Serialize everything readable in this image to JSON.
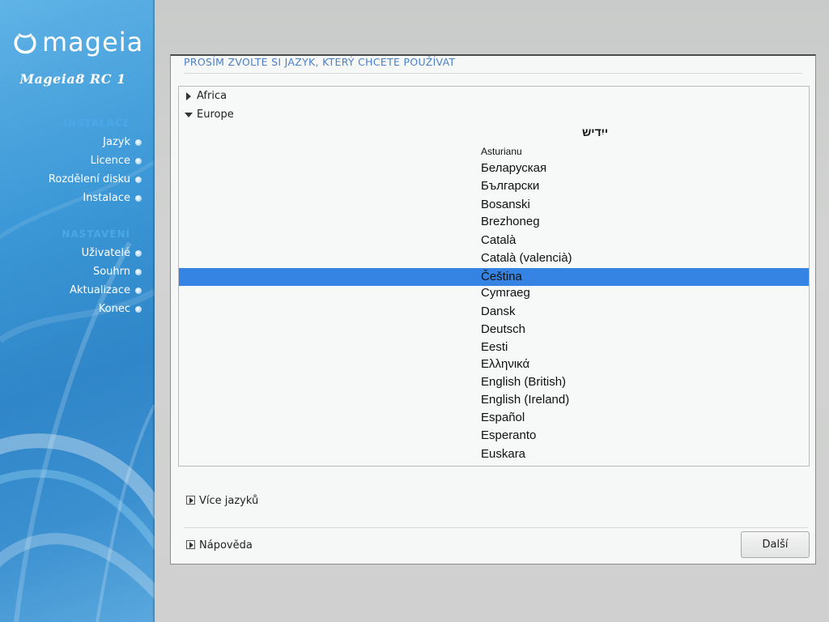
{
  "colors": {
    "sidebar_blue": "#3b97d6",
    "title_blue": "#4c80c6",
    "section_blue": "#4aa7e8",
    "selection": "#3584e4"
  },
  "sidebar": {
    "logo_text": "mageia",
    "version": "Mageia8 RC 1",
    "sections": [
      {
        "title": "INSTALACE",
        "items": [
          {
            "label": "Jazyk"
          },
          {
            "label": "Licence"
          },
          {
            "label": "Rozdělení disku"
          },
          {
            "label": "Instalace"
          }
        ]
      },
      {
        "title": "NASTAVENÍ",
        "items": [
          {
            "label": "Uživatelé"
          },
          {
            "label": "Souhrn"
          },
          {
            "label": "Aktualizace"
          },
          {
            "label": "Konec"
          }
        ]
      }
    ]
  },
  "main": {
    "title": "PROSÍM ZVOLTE SI JAZYK, KTERÝ CHCETE POUŽÍVAT",
    "tree": {
      "groups": [
        {
          "label": "Africa",
          "expanded": false
        },
        {
          "label": "Europe",
          "expanded": true
        }
      ],
      "languages": [
        "ייִדיש",
        "Asturianu",
        "Беларуская",
        "Български",
        "Bosanski",
        "Brezhoneg",
        "Català",
        "Català (valencià)",
        "Čeština",
        "Cymraeg",
        "Dansk",
        "Deutsch",
        "Eesti",
        "Ελληνικά",
        "English (British)",
        "English (Ireland)",
        "Español",
        "Esperanto",
        "Euskara"
      ],
      "selected": "Čeština"
    },
    "more_languages": "Více jazyků",
    "help": "Nápověda",
    "next_button": "Další"
  }
}
